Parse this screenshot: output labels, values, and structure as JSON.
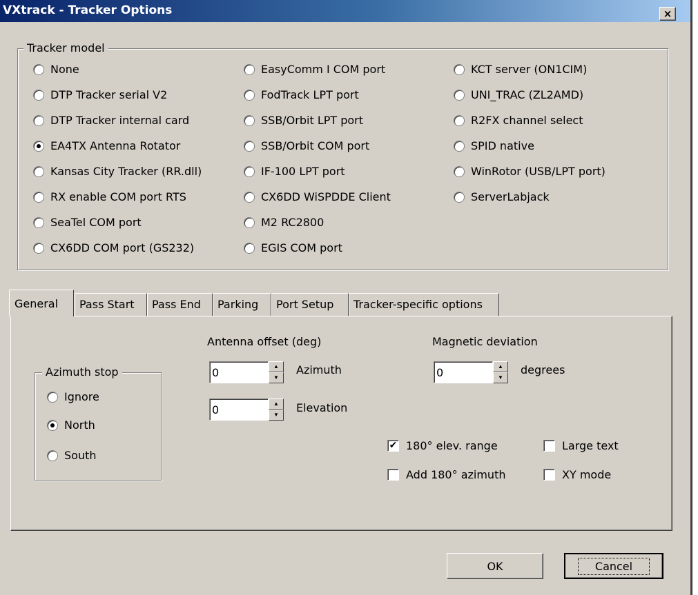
{
  "window": {
    "title": "VXtrack - Tracker Options",
    "close_label": "×"
  },
  "tracker_model": {
    "label": "Tracker model",
    "columns": [
      [
        "None",
        "DTP Tracker serial V2",
        "DTP Tracker internal card",
        "EA4TX Antenna Rotator",
        "Kansas City Tracker (RR.dll)",
        "RX enable COM port RTS",
        "SeaTel COM port",
        "CX6DD COM port (GS232)"
      ],
      [
        "EasyComm I COM port",
        "FodTrack LPT port",
        "SSB/Orbit LPT port",
        "SSB/Orbit COM port",
        "IF-100 LPT port",
        "CX6DD WiSPDDE Client",
        "M2 RC2800",
        "EGIS COM port"
      ],
      [
        "KCT server (ON1CIM)",
        "UNI_TRAC (ZL2AMD)",
        "R2FX channel select",
        "SPID native",
        "WinRotor (USB/LPT port)",
        "ServerLabjack"
      ]
    ],
    "selected": "EA4TX Antenna Rotator"
  },
  "tabs": [
    {
      "label": "General",
      "active": true
    },
    {
      "label": "Pass Start",
      "active": false
    },
    {
      "label": "Pass End",
      "active": false
    },
    {
      "label": "Parking",
      "active": false
    },
    {
      "label": "Port Setup",
      "active": false
    },
    {
      "label": "Tracker-specific options",
      "active": false
    }
  ],
  "general": {
    "azimuth_stop": {
      "label": "Azimuth stop",
      "options": [
        "Ignore",
        "North",
        "South"
      ],
      "selected": "North"
    },
    "antenna_offset": {
      "label": "Antenna offset (deg)",
      "azimuth_value": "0",
      "azimuth_label": "Azimuth",
      "elevation_value": "0",
      "elevation_label": "Elevation"
    },
    "magnetic_deviation": {
      "label": "Magnetic deviation",
      "value": "0",
      "unit": "degrees"
    },
    "checkboxes": [
      {
        "label": "180° elev. range",
        "checked": true
      },
      {
        "label": "Large text",
        "checked": false
      },
      {
        "label": "Add 180° azimuth",
        "checked": false
      },
      {
        "label": "XY mode",
        "checked": false
      }
    ]
  },
  "buttons": {
    "ok": "OK",
    "cancel": "Cancel"
  },
  "icons": {
    "spin_up": "▲",
    "spin_down": "▼",
    "check": "✔"
  }
}
